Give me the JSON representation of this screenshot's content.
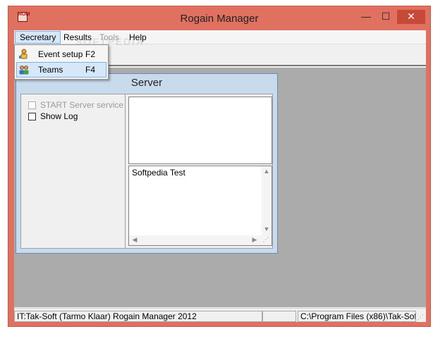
{
  "window": {
    "title": "Rogain Manager",
    "app_icon_text": "ROM",
    "controls": {
      "minimize": "—",
      "maximize": "☐",
      "close": "✕"
    }
  },
  "menubar": {
    "items": [
      {
        "label": "Secretary",
        "state": "active"
      },
      {
        "label": "Results",
        "state": "normal"
      },
      {
        "label": "Tools",
        "state": "disabled"
      },
      {
        "label": "Help",
        "state": "normal"
      }
    ],
    "watermark": "SOFTPEDIA"
  },
  "dropdown": {
    "items": [
      {
        "label": "Event setup",
        "shortcut": "F2",
        "icon": "event-setup-icon",
        "highlighted": false
      },
      {
        "label": "Teams",
        "shortcut": "F4",
        "icon": "teams-icon",
        "highlighted": true
      }
    ]
  },
  "server_window": {
    "title": "Server",
    "start_service_label": "START Server service",
    "start_service_enabled": false,
    "show_log_label": "Show Log",
    "show_log_checked": false,
    "log_text": "Softpedia Test"
  },
  "statusbar": {
    "panels": [
      "IT:Tak-Soft (Tarmo Klaar) Rogain Manager 2012",
      "",
      "",
      "C:\\Program Files (x86)\\Tak-Sof"
    ]
  },
  "colors": {
    "frame": "#e07060",
    "close_button": "#c74a38",
    "highlight": "#d5e7f8",
    "highlight_border": "#7fb1e2",
    "mdi_background": "#ababab",
    "child_frame": "#c8dbed"
  }
}
